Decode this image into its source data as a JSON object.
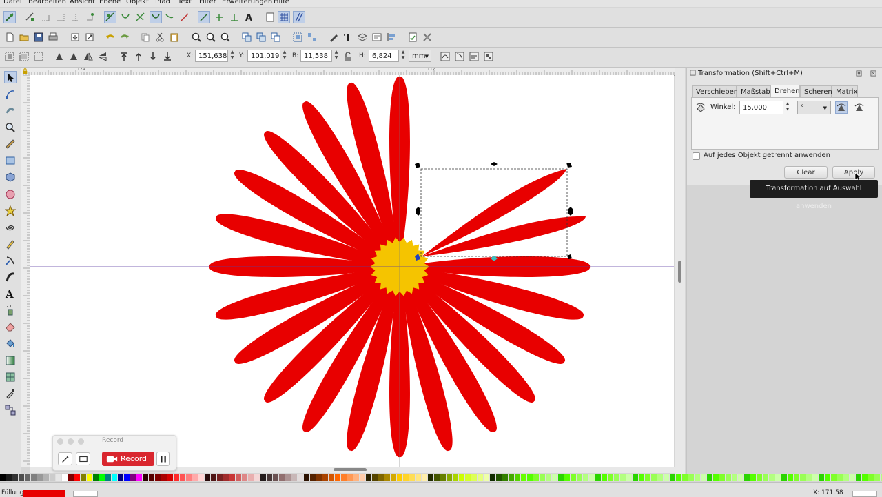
{
  "menu": [
    "Datei",
    "Bearbeiten",
    "Ansicht",
    "Ebene",
    "Objekt",
    "Pfad",
    "Text",
    "Filter",
    "Erweiterungen",
    "Hilfe"
  ],
  "toolcontrols": {
    "x_label": "X:",
    "x_value": "151,638",
    "y_label": "Y:",
    "y_value": "101,019",
    "w_label": "B:",
    "w_value": "11,538",
    "h_label": "H:",
    "h_value": "6,824",
    "unit": "mm"
  },
  "ruler": {
    "h_labels": [
      "124",
      "112"
    ]
  },
  "panel": {
    "title": "Transformation (Shift+Ctrl+M)",
    "tabs": [
      "Verschieben",
      "Maßstab",
      "Drehen",
      "Scheren",
      "Matrix"
    ],
    "active_tab": "Drehen",
    "angle_label": "Winkel:",
    "angle_value": "15,000",
    "angle_unit": "°",
    "separately_label": "Auf jedes Objekt getrennt anwenden",
    "clear_label": "Clear",
    "apply_label": "Apply"
  },
  "tooltip": "Transformation auf Auswahl anwenden",
  "record": {
    "title": "Record",
    "button_label": "Record"
  },
  "status": {
    "fill_label": "Füllung:",
    "text": "...",
    "coords": "X: 171,58"
  },
  "colors": {
    "petal": "#e80000",
    "center": "#f5c400",
    "accent_record": "#d9262e"
  }
}
